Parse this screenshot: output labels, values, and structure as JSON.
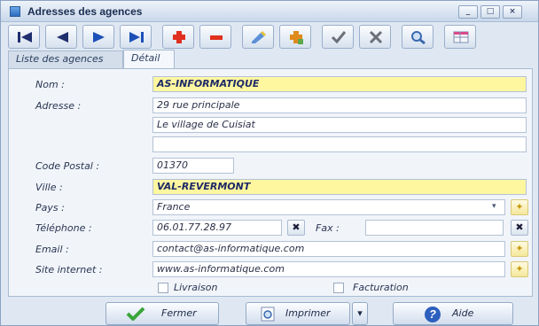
{
  "window": {
    "title": "Adresses des agences"
  },
  "window_controls": {
    "minimize": "_",
    "maximize": "□",
    "close": "×"
  },
  "toolbar": {
    "buttons": [
      {
        "icon": "first-record-icon"
      },
      {
        "icon": "previous-record-icon"
      },
      {
        "icon": "next-record-icon"
      },
      {
        "icon": "last-record-icon"
      },
      {
        "icon": "add-icon"
      },
      {
        "icon": "delete-icon"
      },
      {
        "icon": "edit-icon"
      },
      {
        "icon": "duplicate-icon"
      },
      {
        "icon": "validate-icon"
      },
      {
        "icon": "cancel-icon"
      },
      {
        "icon": "search-icon"
      },
      {
        "icon": "table-icon"
      }
    ]
  },
  "tabs": [
    {
      "label": "Liste des agences"
    },
    {
      "label": "Détail"
    }
  ],
  "form": {
    "nom_label": "Nom :",
    "nom_value": "AS-INFORMATIQUE",
    "adresse_label": "Adresse :",
    "adresse_line1": "29 rue principale",
    "adresse_line2": "Le village de Cuisiat",
    "adresse_line3": "",
    "code_postal_label": "Code Postal :",
    "code_postal_value": "01370",
    "ville_label": "Ville :",
    "ville_value": "VAL-REVERMONT",
    "pays_label": "Pays :",
    "pays_value": "France",
    "telephone_label": "Téléphone :",
    "telephone_value": "06.01.77.28.97",
    "fax_label": "Fax :",
    "fax_value": "",
    "email_label": "Email :",
    "email_value": "contact@as-informatique.com",
    "site_label": "Site internet :",
    "site_value": "www.as-informatique.com",
    "livraison_label": "Livraison",
    "livraison_checked": false,
    "facturation_label": "Facturation",
    "facturation_checked": false
  },
  "footer": {
    "fermer_label": "Fermer",
    "imprimer_label": "Imprimer",
    "aide_label": "Aide"
  },
  "colors": {
    "highlight_field": "#fff7a0",
    "window_background": "#dfe8f2",
    "panel_background": "#f1f5fa"
  }
}
